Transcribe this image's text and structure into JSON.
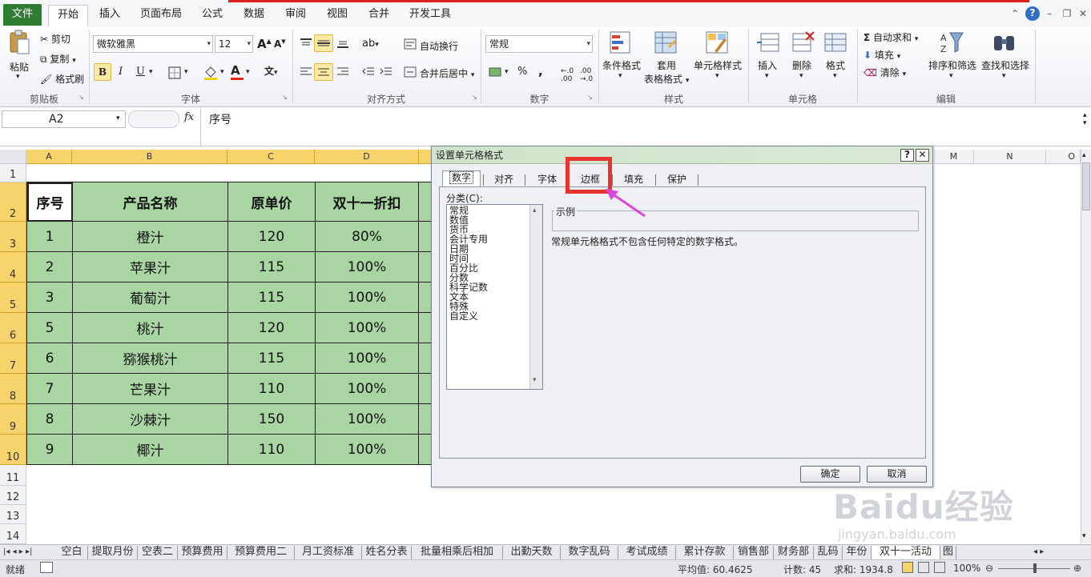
{
  "ribbon_tabs": [
    "文件",
    "开始",
    "插入",
    "页面布局",
    "公式",
    "数据",
    "审阅",
    "视图",
    "合并",
    "开发工具"
  ],
  "active_tab": "开始",
  "clipboard": {
    "paste": "粘贴",
    "cut": "剪切",
    "copy": "复制",
    "painter": "格式刷",
    "label": "剪贴板"
  },
  "font": {
    "name": "微软雅黑",
    "size": "12",
    "label": "字体",
    "bold": "B",
    "italic": "I",
    "underline": "U",
    "grow": "A",
    "shrink": "A",
    "color_letter": "A"
  },
  "align": {
    "wrap": "自动换行",
    "merge": "合并后居中",
    "label": "对齐方式"
  },
  "number": {
    "format": "常规",
    "percent": "%",
    "comma": ",",
    "label": "数字"
  },
  "styles": {
    "cond": "条件格式",
    "table_top": "套用",
    "table_bottom": "表格格式",
    "cellstyle": "单元格样式",
    "label": "样式"
  },
  "cells": {
    "insert": "插入",
    "delete": "删除",
    "format": "格式",
    "label": "单元格"
  },
  "editing": {
    "autosum": "自动求和",
    "fill": "填充",
    "clear": "清除",
    "sort": "排序和筛选",
    "find": "查找和选择",
    "label": "编辑"
  },
  "namebox": "A2",
  "fx": "fx",
  "formula": "序号",
  "columns": [
    "A",
    "B",
    "C",
    "D",
    "M",
    "N",
    "O"
  ],
  "rows": [
    "1",
    "2",
    "3",
    "4",
    "5",
    "6",
    "7",
    "8",
    "9",
    "10",
    "11",
    "12",
    "13",
    "14"
  ],
  "table": {
    "headers": [
      "序号",
      "产品名称",
      "原单价",
      "双十一折扣"
    ],
    "rows": [
      [
        "1",
        "橙汁",
        "120",
        "80%"
      ],
      [
        "2",
        "苹果汁",
        "115",
        "100%"
      ],
      [
        "3",
        "葡萄汁",
        "115",
        "100%"
      ],
      [
        "5",
        "桃汁",
        "120",
        "100%"
      ],
      [
        "6",
        "猕猴桃汁",
        "115",
        "100%"
      ],
      [
        "7",
        "芒果汁",
        "110",
        "100%"
      ],
      [
        "8",
        "沙棘汁",
        "150",
        "100%"
      ],
      [
        "9",
        "椰汁",
        "110",
        "100%"
      ]
    ]
  },
  "dialog": {
    "title": "设置单元格格式",
    "help": "?",
    "close": "✕",
    "tabs": [
      "数字",
      "对齐",
      "字体",
      "边框",
      "填充",
      "保护"
    ],
    "active_tab": "数字",
    "category_label": "分类(C):",
    "categories": [
      "常规",
      "数值",
      "货币",
      "会计专用",
      "日期",
      "时间",
      "百分比",
      "分数",
      "科学记数",
      "文本",
      "特殊",
      "自定义"
    ],
    "sample_label": "示例",
    "description": "常规单元格格式不包含任何特定的数字格式。",
    "ok": "确定",
    "cancel": "取消"
  },
  "sheet_tabs": [
    "空白",
    "提取月份",
    "空表二",
    "预算费用",
    "预算费用二",
    "月工资标准",
    "姓名分表",
    "批量相乘后相加",
    "出勤天数",
    "数字乱码",
    "考试成绩",
    "累计存款",
    "销售部",
    "财务部",
    "乱码",
    "年份",
    "双十一活动",
    "图"
  ],
  "active_sheet": "双十一活动",
  "status": {
    "ready": "就绪",
    "average": "平均值: 60.4625",
    "count": "计数: 45",
    "sum": "求和: 1934.8",
    "zoom": "100%"
  },
  "watermark": {
    "brand": "Baidu经验",
    "url": "jingyan.baidu.com"
  },
  "colors": {
    "file_tab": "#2e7d32",
    "cell_fill": "#a8d5a2",
    "highlight_box": "#e8342f",
    "arrow": "#d946d9"
  }
}
